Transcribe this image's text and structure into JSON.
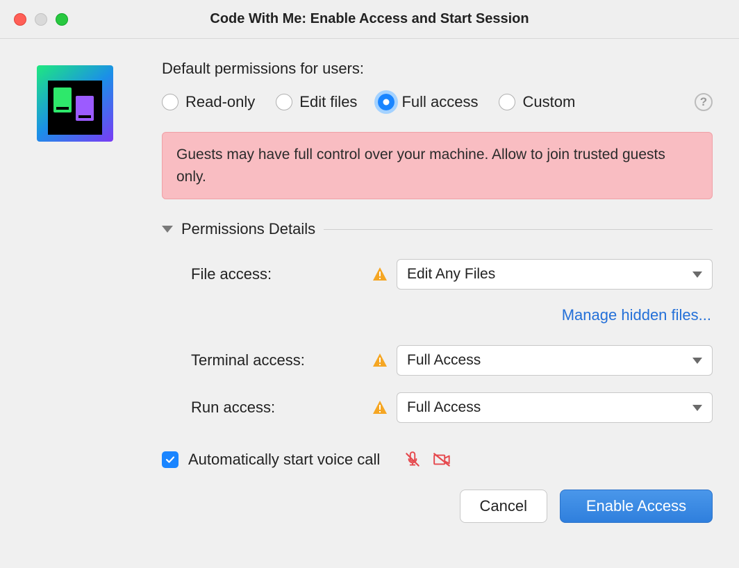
{
  "window": {
    "title": "Code With Me: Enable Access and Start Session"
  },
  "heading": "Default permissions for users:",
  "radios": {
    "readonly": "Read-only",
    "editfiles": "Edit files",
    "fullaccess": "Full access",
    "custom": "Custom"
  },
  "warning": "Guests may have full control over your machine. Allow to join trusted guests only.",
  "section": {
    "title": "Permissions Details"
  },
  "details": {
    "file_label": "File access:",
    "file_value": "Edit Any Files",
    "manage_link": "Manage hidden files...",
    "terminal_label": "Terminal access:",
    "terminal_value": "Full Access",
    "run_label": "Run access:",
    "run_value": "Full Access"
  },
  "voice": {
    "label": "Automatically start voice call"
  },
  "buttons": {
    "cancel": "Cancel",
    "enable": "Enable Access"
  }
}
